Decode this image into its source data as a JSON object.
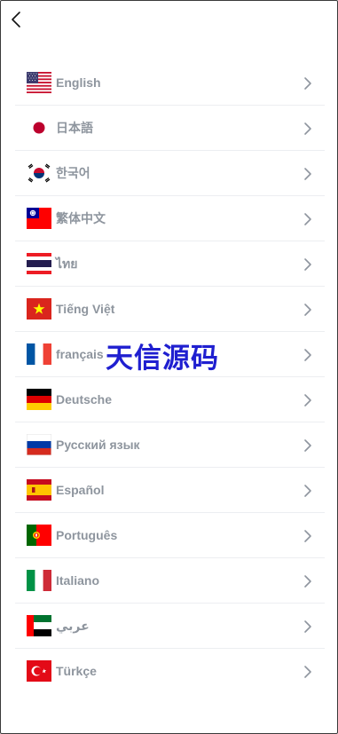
{
  "header": {
    "back_icon": "back-arrow-icon"
  },
  "languages": [
    {
      "label": "English",
      "flag": "us-flag-icon"
    },
    {
      "label": "日本語",
      "flag": "japan-flag-icon"
    },
    {
      "label": "한국어",
      "flag": "korea-flag-icon"
    },
    {
      "label": "繁体中文",
      "flag": "taiwan-flag-icon"
    },
    {
      "label": "ไทย",
      "flag": "thailand-flag-icon"
    },
    {
      "label": "Tiếng Việt",
      "flag": "vietnam-flag-icon"
    },
    {
      "label": "français",
      "flag": "france-flag-icon"
    },
    {
      "label": "Deutsche",
      "flag": "germany-flag-icon"
    },
    {
      "label": "Русский язык",
      "flag": "russia-flag-icon"
    },
    {
      "label": "Español",
      "flag": "spain-flag-icon"
    },
    {
      "label": "Português",
      "flag": "portugal-flag-icon"
    },
    {
      "label": "Italiano",
      "flag": "italy-flag-icon"
    },
    {
      "label": "عربي",
      "flag": "uae-flag-icon"
    },
    {
      "label": "Türkçe",
      "flag": "turkey-flag-icon"
    }
  ],
  "watermark": "天信源码",
  "colors": {
    "label": "#8e959e",
    "divider": "#eceef1",
    "chevron": "#8e959e",
    "watermark": "#1f1fd0"
  }
}
